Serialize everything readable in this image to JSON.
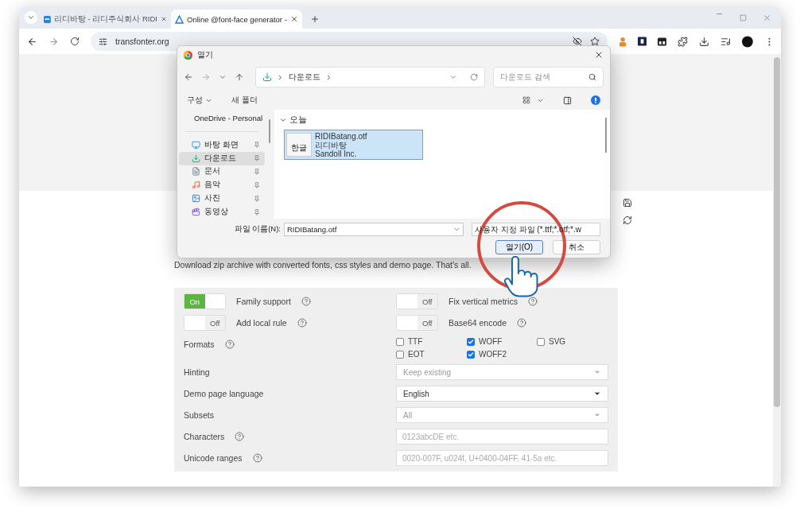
{
  "browser": {
    "tabs": [
      {
        "title": "리디바탕 - 리디주식회사 RIDI",
        "selected": false
      },
      {
        "title": "Online @font-face generator -",
        "selected": true
      }
    ],
    "address": "transfonter.org"
  },
  "page": {
    "download_note": "Download zip archive with converted fonts, css styles and demo page. That's all.",
    "toggles": [
      {
        "label": "Family support",
        "on": true,
        "state_text": "On",
        "help": true
      },
      {
        "label": "Fix vertical metrics",
        "on": false,
        "state_text": "Off",
        "help": true
      },
      {
        "label": "Add local rule",
        "on": false,
        "state_text": "Off",
        "help": true
      },
      {
        "label": "Base64 encode",
        "on": false,
        "state_text": "Off",
        "help": true
      }
    ],
    "formats": {
      "label": "Formats",
      "help": true,
      "options": [
        {
          "label": "TTF",
          "checked": false
        },
        {
          "label": "WOFF",
          "checked": true
        },
        {
          "label": "SVG",
          "checked": false
        },
        {
          "label": "EOT",
          "checked": false
        },
        {
          "label": "WOFF2",
          "checked": true
        }
      ]
    },
    "fields": [
      {
        "kind": "select",
        "label": "Hinting",
        "value": "Keep existing",
        "disabled": true,
        "help": false
      },
      {
        "kind": "select",
        "label": "Demo page language",
        "value": "English",
        "disabled": false,
        "help": false
      },
      {
        "kind": "select",
        "label": "Subsets",
        "value": "All",
        "disabled": true,
        "help": false
      },
      {
        "kind": "input",
        "label": "Characters",
        "placeholder": "0123abcDE etc.",
        "help": true
      },
      {
        "kind": "input",
        "label": "Unicode ranges",
        "placeholder": "0020-007F, u024f, U+0400-04FF, 41-5a etc.",
        "help": true
      }
    ]
  },
  "dialog": {
    "title": "열기",
    "path": "다운로드",
    "search_placeholder": "다운로드 검색",
    "commands": [
      {
        "label": "구성",
        "menu": true
      },
      {
        "label": "새 폴더",
        "menu": false
      }
    ],
    "nav_cloud": "OneDrive - Personal",
    "nav_items": [
      {
        "kind": "desktop",
        "label": "바탕 화면",
        "selected": false
      },
      {
        "kind": "downloads",
        "label": "다운로드",
        "selected": true
      },
      {
        "kind": "documents",
        "label": "문서",
        "selected": false
      },
      {
        "kind": "music",
        "label": "음악",
        "selected": false
      },
      {
        "kind": "pictures",
        "label": "사진",
        "selected": false
      },
      {
        "kind": "videos",
        "label": "동영상",
        "selected": false
      }
    ],
    "group": {
      "label": "오늘",
      "expanded": true
    },
    "files": [
      {
        "thumb": "한글",
        "name": "RIDIBatang.otf",
        "title": "리디바탕",
        "author": "Sandoll Inc.",
        "selected": true
      }
    ],
    "filename_label": "파일 이름(N):",
    "filename": "RIDIBatang.otf",
    "filter": "사용자 지정 파일 (*.ttf;*.otf;*.w",
    "buttons": [
      {
        "label": "열기(O)",
        "default": true
      },
      {
        "label": "취소",
        "default": false
      }
    ]
  }
}
